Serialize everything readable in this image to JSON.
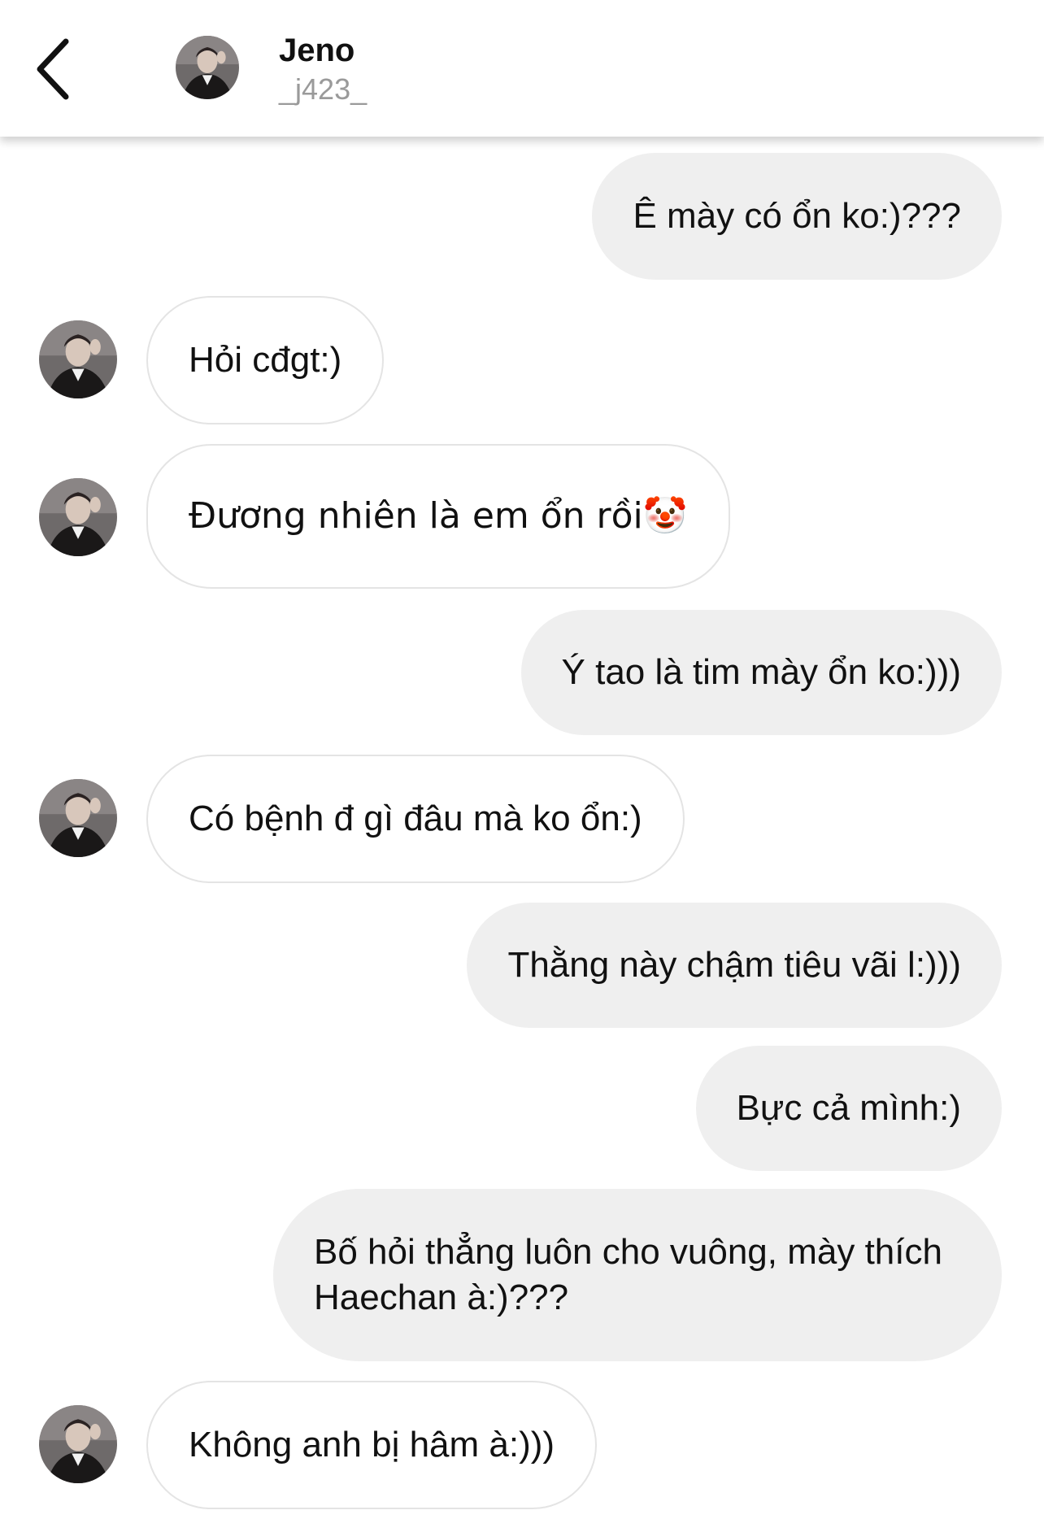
{
  "header": {
    "back_icon": "chevron-left-icon",
    "name": "Jeno",
    "handle": "_j423_"
  },
  "messages": [
    {
      "direction": "outgoing",
      "text": "Ê mày có ổn ko:)???"
    },
    {
      "direction": "incoming",
      "text": "Hỏi cđgt:)"
    },
    {
      "direction": "incoming",
      "text": "Đương nhiên là em ổn rồi🤡"
    },
    {
      "direction": "outgoing",
      "text": "Ý tao là tim mày ổn ko:)))"
    },
    {
      "direction": "incoming",
      "text": "Có bệnh đ gì đâu mà ko ổn:)"
    },
    {
      "direction": "outgoing",
      "text": "Thằng này chậm tiêu vãi  l:)))"
    },
    {
      "direction": "outgoing",
      "text": "Bực cả mình:)"
    },
    {
      "direction": "outgoing",
      "text": "Bố hỏi thẳng luôn cho vuông, mày thích Haechan à:)???"
    },
    {
      "direction": "incoming",
      "text": "Không anh bị hâm à:)))"
    }
  ],
  "colors": {
    "outgoing_bubble": "#efefef",
    "incoming_border": "#e4e4e4",
    "handle_text": "#9a9a9a"
  }
}
